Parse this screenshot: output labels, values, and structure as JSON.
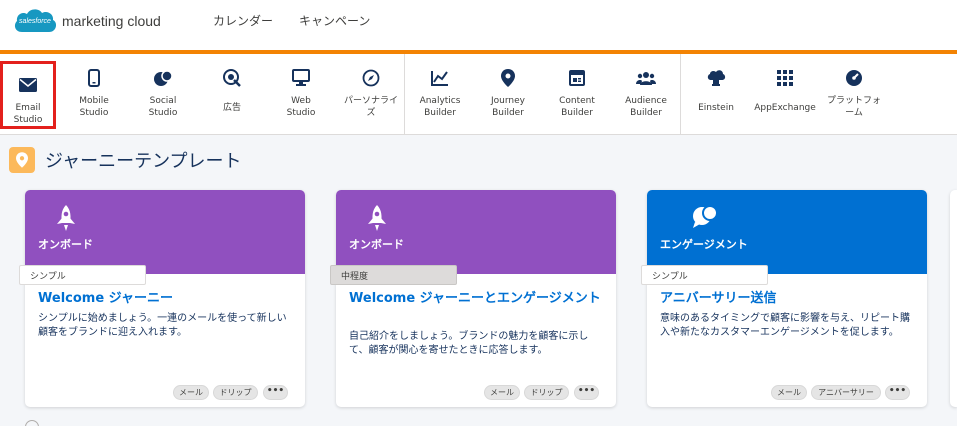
{
  "header": {
    "logo_badge": "salesforce",
    "logo_text": "marketing cloud",
    "nav": [
      "カレンダー",
      "キャンペーン"
    ]
  },
  "colors": {
    "accent_orange": "#f38303",
    "onboard_purple": "#9050bf",
    "engagement_blue": "#0070d2",
    "selected_outline": "#e3201c"
  },
  "apps": [
    {
      "label": "Email\nStudio",
      "icon": "email-icon",
      "selected": true
    },
    {
      "label": "Mobile\nStudio",
      "icon": "mobile-icon"
    },
    {
      "label": "Social\nStudio",
      "icon": "social-icon"
    },
    {
      "label": "広告",
      "icon": "ads-icon"
    },
    {
      "label": "Web\nStudio",
      "icon": "monitor-icon"
    },
    {
      "label": "パーソナライ\nズ",
      "icon": "compass-icon"
    },
    {
      "label": "Analytics\nBuilder",
      "icon": "line-chart-icon"
    },
    {
      "label": "Journey\nBuilder",
      "icon": "location-pin-icon"
    },
    {
      "label": "Content\nBuilder",
      "icon": "content-icon"
    },
    {
      "label": "Audience\nBuilder",
      "icon": "people-icon"
    },
    {
      "label": "Einstein",
      "icon": "einstein-icon"
    },
    {
      "label": "AppExchange",
      "icon": "grid-icon"
    },
    {
      "label": "プラットフォ\nーム",
      "icon": "gauge-icon"
    }
  ],
  "section": {
    "title": "ジャーニーテンプレート",
    "icon": "location-pin-icon"
  },
  "cards": [
    {
      "category": "オンボード",
      "icon": "rocket-icon",
      "level": "シンプル",
      "title": "Welcome ジャーニー",
      "description": "シンプルに始めましょう。一連のメールを使って新しい顧客をブランドに迎え入れます。",
      "tags": [
        "メール",
        "ドリップ"
      ],
      "more": "•••"
    },
    {
      "category": "オンボード",
      "icon": "rocket-icon",
      "level": "中程度",
      "title": "Welcome ジャーニーとエンゲージメント",
      "description": "自己紹介をしましょう。ブランドの魅力を顧客に示して、顧客が関心を寄せたときに応答します。",
      "tags": [
        "メール",
        "ドリップ"
      ],
      "more": "•••"
    },
    {
      "category": "エンゲージメント",
      "icon": "chat-bubbles-icon",
      "level": "シンプル",
      "title": "アニバーサリー送信",
      "description": "意味のあるタイミングで顧客に影響を与え、リピート購入や新たなカスタマーエンゲージメントを促します。",
      "tags": [
        "メール",
        "アニバーサリー"
      ],
      "more": "•••"
    }
  ]
}
